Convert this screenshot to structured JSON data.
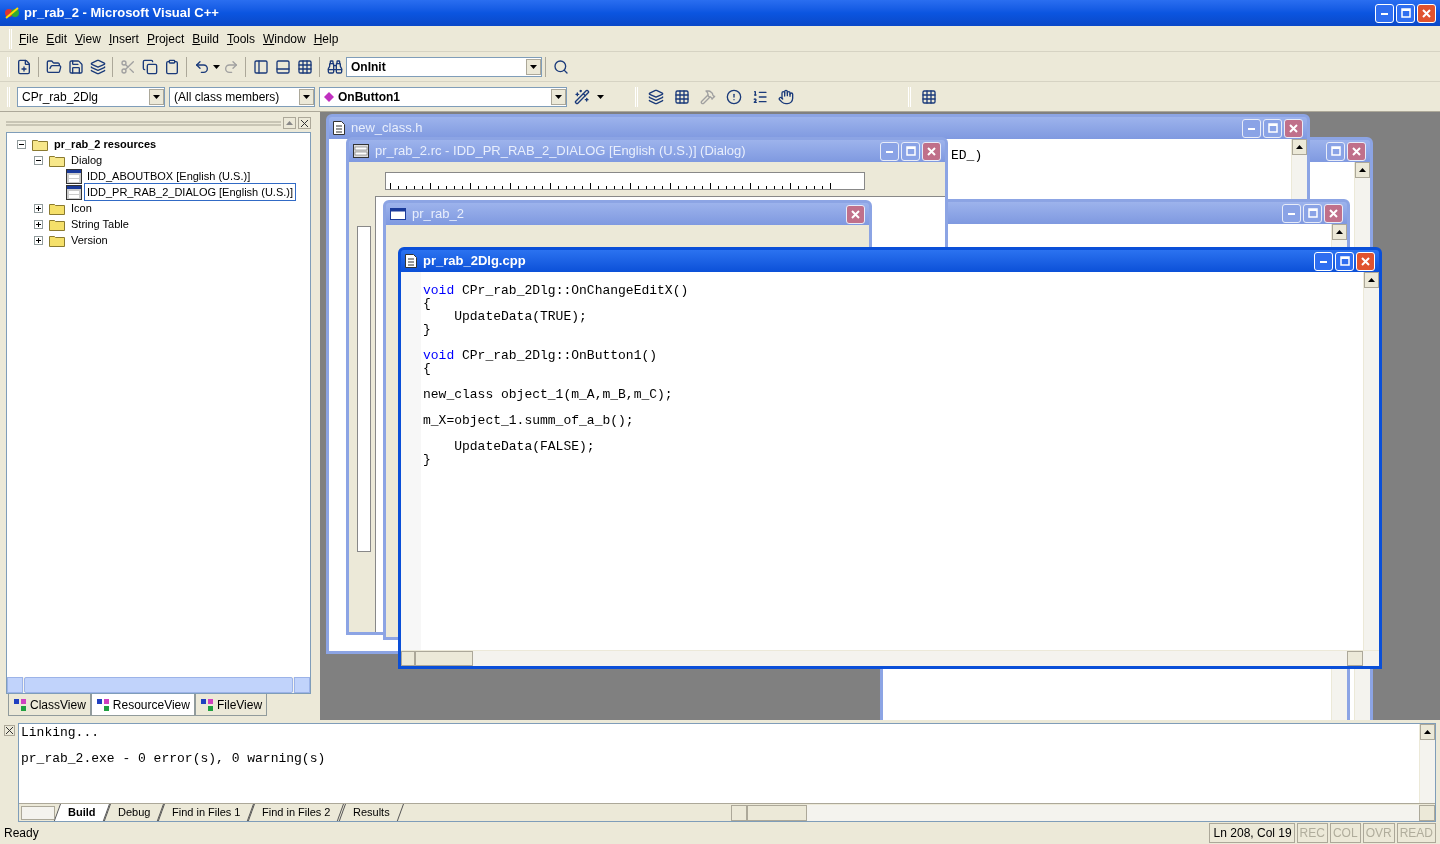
{
  "window": {
    "title": "pr_rab_2 - Microsoft Visual C++"
  },
  "menu": [
    {
      "label": "File"
    },
    {
      "label": "Edit"
    },
    {
      "label": "View"
    },
    {
      "label": "Insert"
    },
    {
      "label": "Project"
    },
    {
      "label": "Build"
    },
    {
      "label": "Tools"
    },
    {
      "label": "Window"
    },
    {
      "label": "Help"
    }
  ],
  "toolbar": {
    "function_combo": "OnInit"
  },
  "wizard_bar": {
    "class_combo": "CPr_rab_2Dlg",
    "filter_combo": "(All class members)",
    "member_combo": "OnButton1"
  },
  "workspace": {
    "tree": [
      {
        "label": "pr_rab_2 resources",
        "bold": true,
        "expanded": true,
        "selected": false,
        "children": [
          {
            "label": "Dialog",
            "bold": false,
            "expanded": true,
            "selected": false,
            "children": [
              {
                "label": "IDD_ABOUTBOX [English (U.S.)]",
                "bold": false,
                "selected": false
              },
              {
                "label": "IDD_PR_RAB_2_DIALOG [English (U.S.)]",
                "bold": false,
                "selected": true
              }
            ]
          },
          {
            "label": "Icon",
            "bold": false,
            "expanded": false,
            "selected": false
          },
          {
            "label": "String Table",
            "bold": false,
            "expanded": false,
            "selected": false
          },
          {
            "label": "Version",
            "bold": false,
            "expanded": false,
            "selected": false
          }
        ]
      }
    ],
    "tabs": [
      {
        "label": "ClassView",
        "selected": false
      },
      {
        "label": "ResourceView",
        "selected": true
      },
      {
        "label": "FileView",
        "selected": false
      }
    ]
  },
  "mdi_windows": [
    {
      "kind": "editor",
      "active": false
    },
    {
      "kind": "editor",
      "title": "new_class.h",
      "active": false,
      "text": "ED_)"
    },
    {
      "kind": "editor",
      "active": false
    },
    {
      "kind": "dialog_editor",
      "title": "pr_rab_2.rc - IDD_PR_RAB_2_DIALOG [English (U.S.)] (Dialog)",
      "active": false
    },
    {
      "kind": "dialog",
      "title": "pr_rab_2",
      "active": false
    },
    {
      "kind": "code",
      "title": "pr_rab_2Dlg.cpp",
      "active": true,
      "lines": [
        {
          "kind": "code",
          "keyword": "void",
          "text": " CPr_rab_2Dlg::OnChangeEditX()"
        },
        {
          "kind": "code",
          "text": "{"
        },
        {
          "kind": "code",
          "text": "    UpdateData(TRUE);"
        },
        {
          "kind": "code",
          "text": "}"
        },
        {
          "kind": "blank"
        },
        {
          "kind": "code",
          "keyword": "void",
          "text": " CPr_rab_2Dlg::OnButton1()"
        },
        {
          "kind": "code",
          "text": "{"
        },
        {
          "kind": "blank"
        },
        {
          "kind": "code",
          "text": "new_class object_1(m_A,m_B,m_C);"
        },
        {
          "kind": "blank"
        },
        {
          "kind": "code",
          "text": "m_X=object_1.summ_of_a_b();"
        },
        {
          "kind": "blank"
        },
        {
          "kind": "code",
          "text": "    UpdateData(FALSE);"
        },
        {
          "kind": "code",
          "text": "}"
        }
      ]
    }
  ],
  "output": {
    "lines": [
      "Linking...",
      "pr_rab_2.exe - 0 error(s), 0 warning(s)"
    ],
    "tabs": [
      {
        "label": "Build",
        "selected": true
      },
      {
        "label": "Debug",
        "selected": false
      },
      {
        "label": "Find in Files 1",
        "selected": false
      },
      {
        "label": "Find in Files 2",
        "selected": false
      },
      {
        "label": "Results",
        "selected": false
      }
    ]
  },
  "status_bar": {
    "message": "Ready",
    "position": "Ln 208, Col 19",
    "indicators": [
      {
        "label": "REC",
        "on": false
      },
      {
        "label": "COL",
        "on": false
      },
      {
        "label": "OVR",
        "on": false
      },
      {
        "label": "READ",
        "on": false
      }
    ]
  }
}
